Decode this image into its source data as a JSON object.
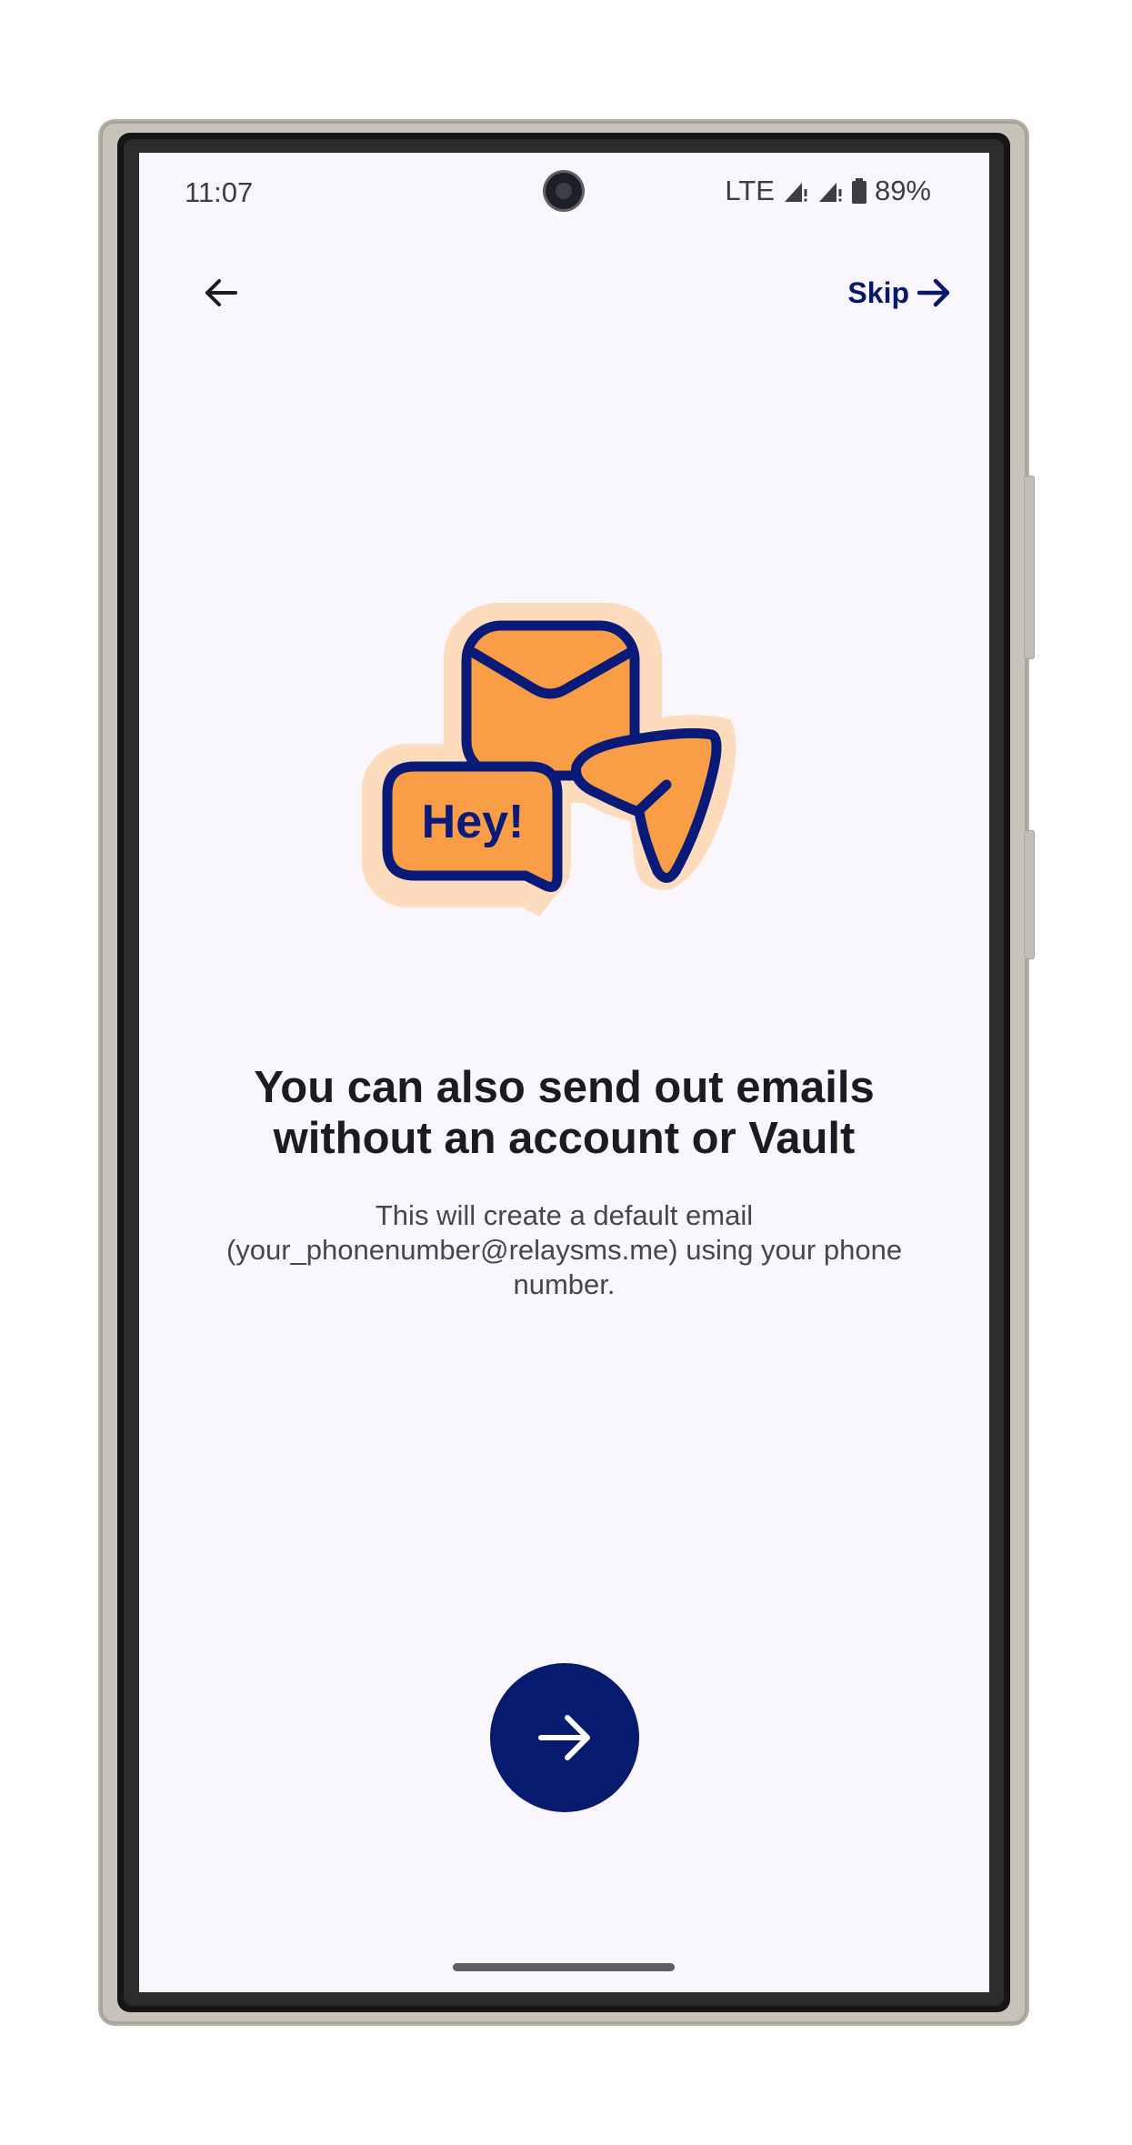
{
  "status_bar": {
    "time": "11:07",
    "network": "LTE",
    "battery": "89%",
    "icons": [
      "signal-icon",
      "signal-icon",
      "battery-icon"
    ]
  },
  "top_bar": {
    "back_icon": "arrow-left-icon",
    "skip_label": "Skip",
    "skip_icon": "arrow-right-icon"
  },
  "illustration": {
    "name": "messaging-illustration",
    "bubble_text": "Hey!",
    "colors": {
      "fill": "#F99E46",
      "outline": "#0A1A78",
      "halo": "#FDDCBE"
    }
  },
  "content": {
    "headline": "You can also send out emails without an account or Vault",
    "body": "This will create a default email (your_phonenumber@relaysms.me) using your phone number."
  },
  "next_button": {
    "icon": "arrow-right-icon",
    "color": "#061B6E"
  }
}
